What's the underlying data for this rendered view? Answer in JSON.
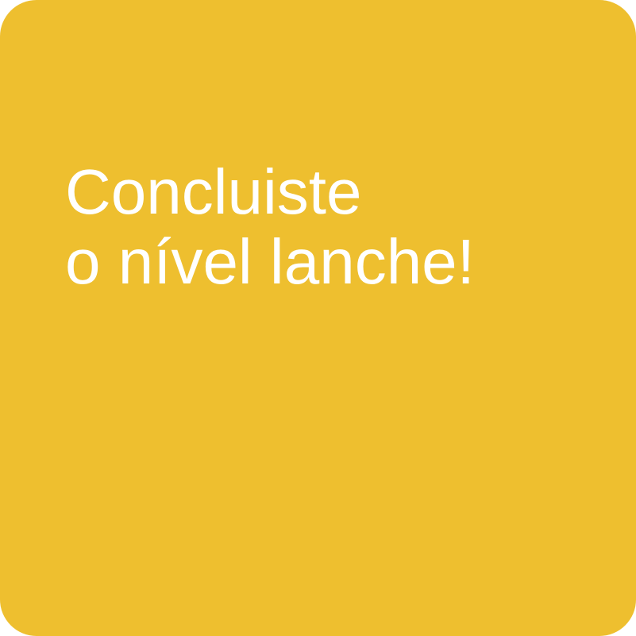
{
  "card": {
    "background_color": "#EEBF2F",
    "text_color": "#FFFFFF",
    "message_lines": [
      "Concluiste",
      "o nível lanche!"
    ]
  }
}
